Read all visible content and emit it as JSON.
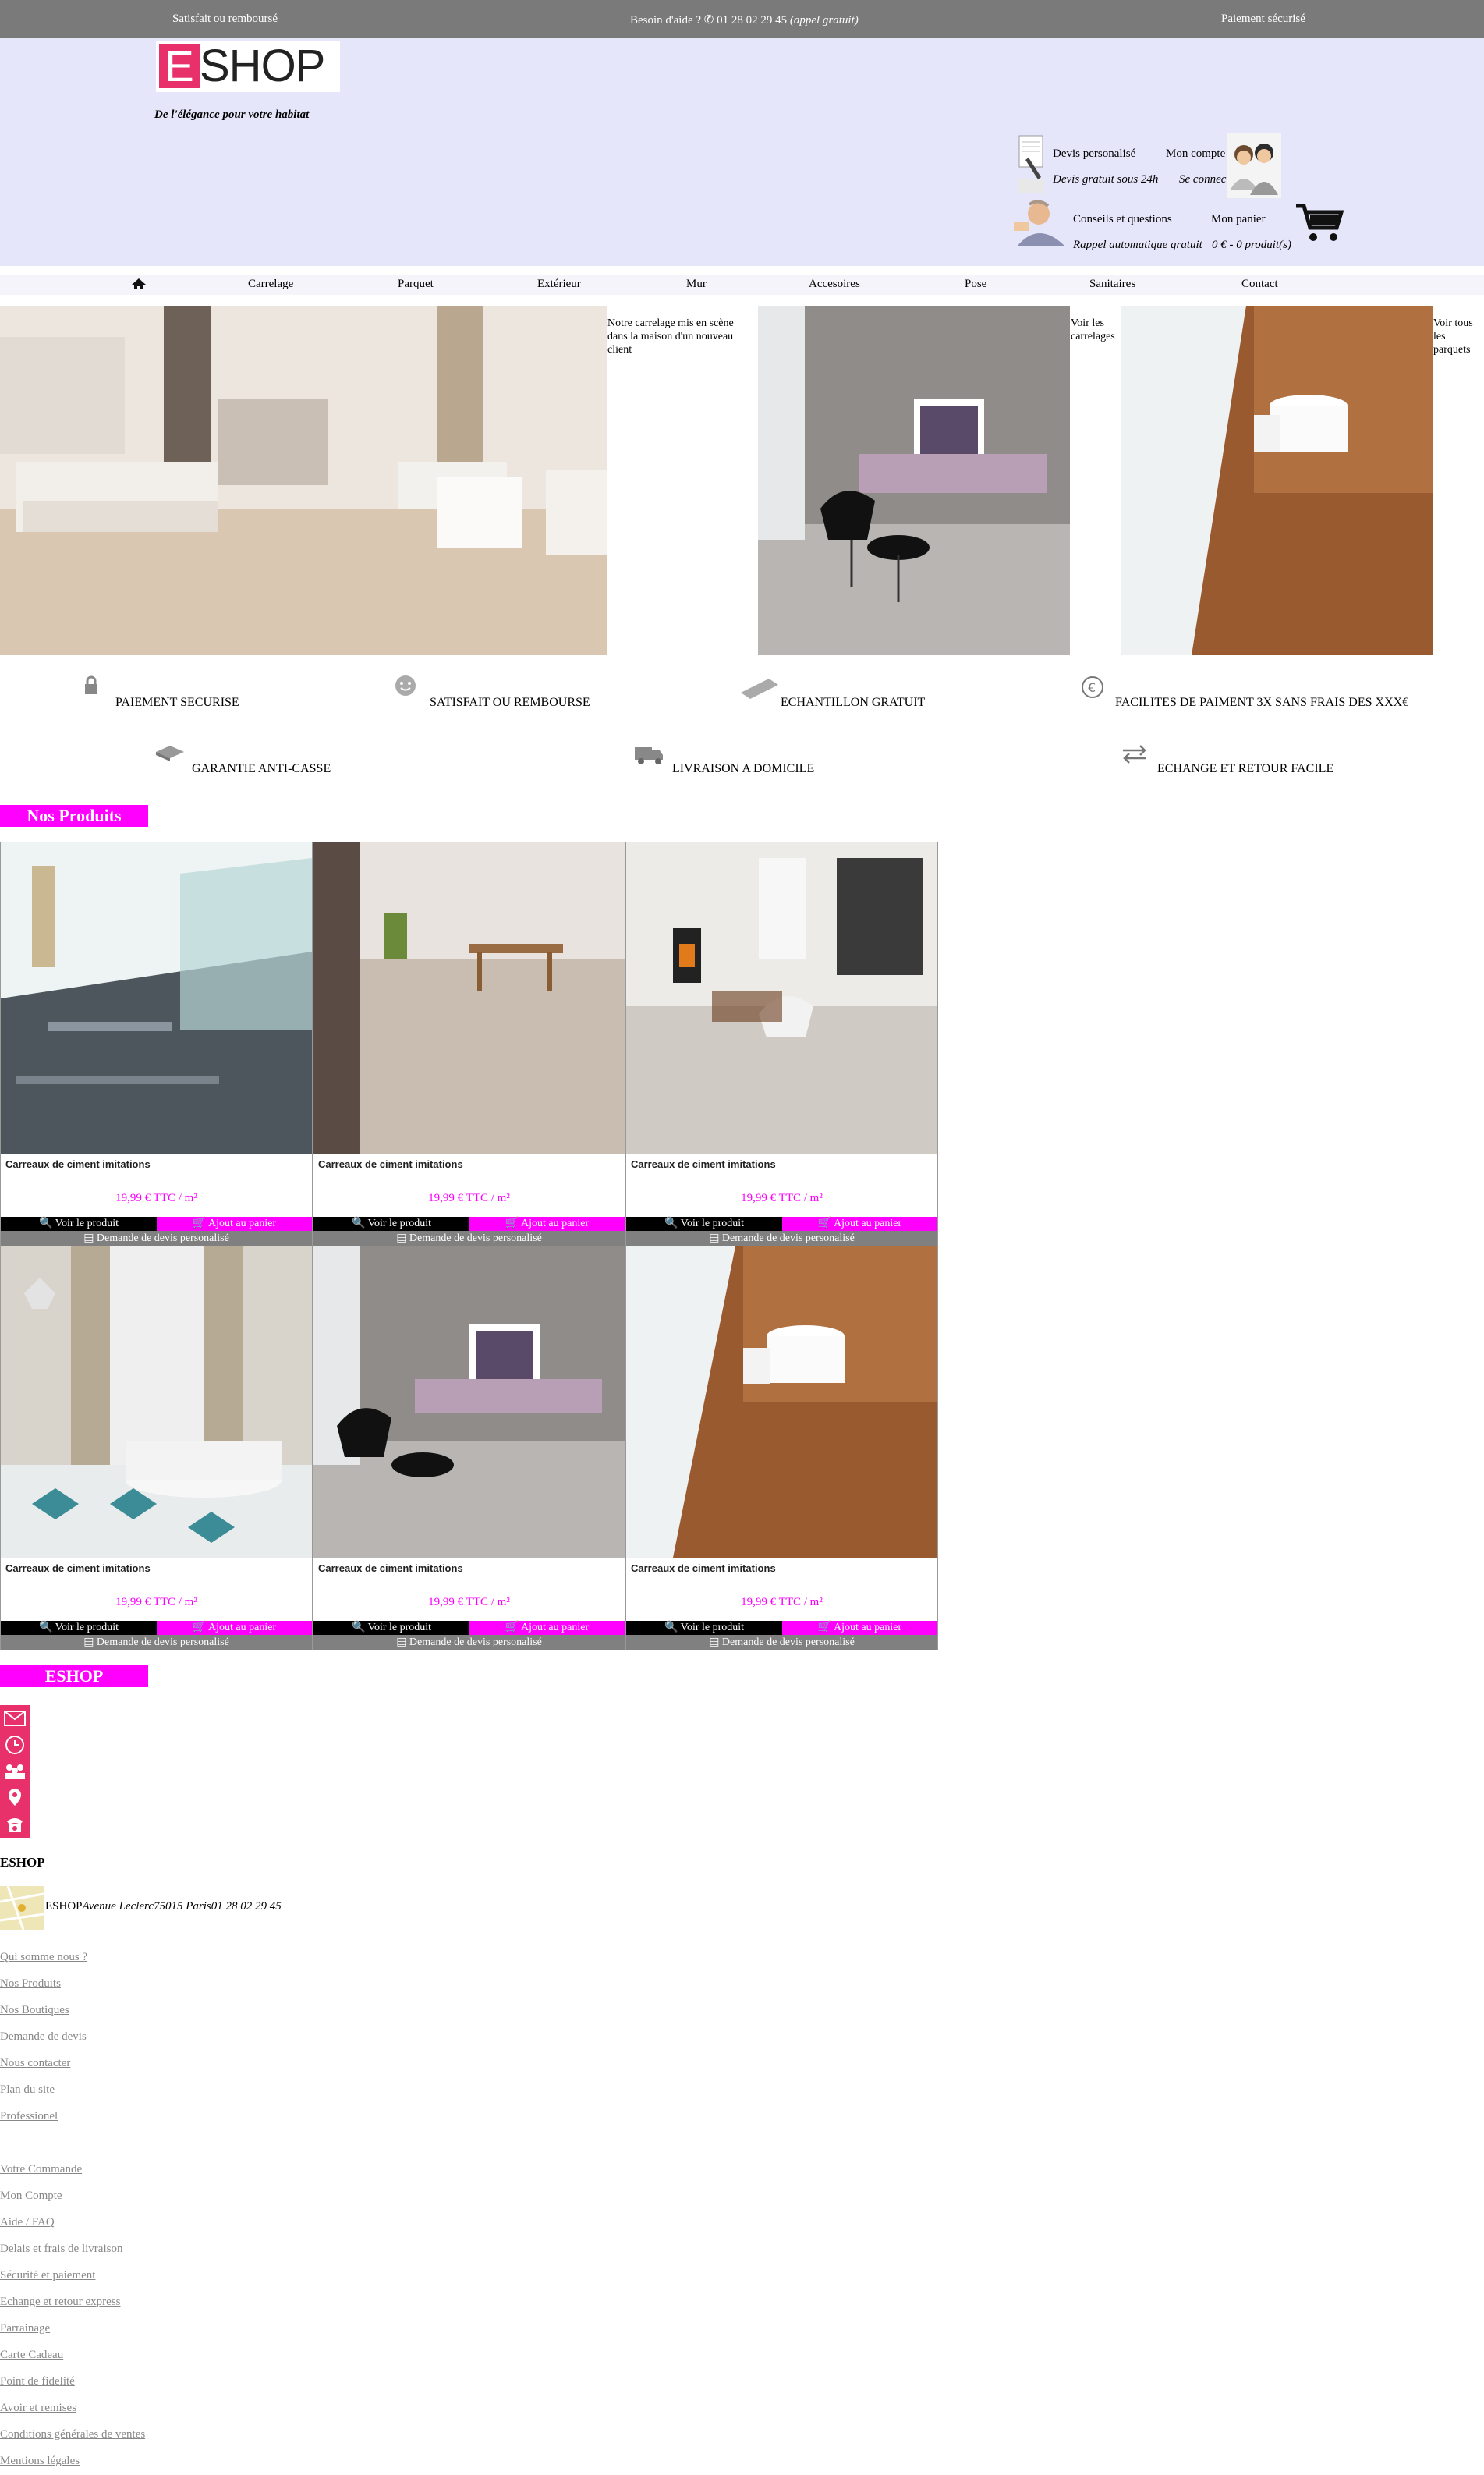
{
  "topbar": {
    "left": "Satisfait ou remboursé",
    "center_prefix": "Besoin d'aide ?",
    "phone": "01 28 02 29 45",
    "phone_note": "(appel gratuit)",
    "right": "Paiement sécurisé"
  },
  "header": {
    "logo_letter": "E",
    "logo_rest": "SHOP",
    "tagline": "De l'élégance pour votre habitat",
    "quote_label": "Devis personalisé",
    "quote_sub": "Devis gratuit sous 24h",
    "account_label": "Mon compte",
    "account_sub": "Se connecter",
    "advice_label": "Conseils et questions",
    "advice_sub": "Rappel automatique gratuit",
    "cart_label": "Mon panier",
    "cart_sub": "0 € - 0 produit(s)"
  },
  "nav": {
    "items": [
      "Carrelage",
      "Parquet",
      "Extérieur",
      "Mur",
      "Accesoires",
      "Pose",
      "Sanitaires",
      "Contact"
    ]
  },
  "hero": {
    "caption1": "Notre carrelage mis en scène dans la maison d'un nouveau client",
    "caption2": "Voir les carrelages",
    "caption3": "Voir tous les parquets"
  },
  "features": {
    "row1": [
      "PAIEMENT SECURISE",
      "SATISFAIT OU REMBOURSE",
      "ECHANTILLON GRATUIT",
      "FACILITES DE PAIMENT 3X SANS FRAIS DES XXX€"
    ],
    "row2": [
      "GARANTIE ANTI-CASSE",
      "LIVRAISON A DOMICILE",
      "ECHANGE ET RETOUR FACILE"
    ]
  },
  "products": {
    "section_title": "Nos Produits",
    "items": [
      {
        "name": "Carreaux de ciment imitations",
        "price": "19,99 € TTC / m²"
      },
      {
        "name": "Carreaux de ciment imitations",
        "price": "19,99 € TTC / m²"
      },
      {
        "name": "Carreaux de ciment imitations",
        "price": "19,99 € TTC / m²"
      },
      {
        "name": "Carreaux de ciment imitations",
        "price": "19,99 € TTC / m²"
      },
      {
        "name": "Carreaux de ciment imitations",
        "price": "19,99 € TTC / m²"
      },
      {
        "name": "Carreaux de ciment imitations",
        "price": "19,99 € TTC / m²"
      }
    ],
    "view_label": "Voir le produit",
    "cart_label": "Ajout au panier",
    "quote_label": "Demande de devis personalisé"
  },
  "eshop_section": {
    "title": "ESHOP",
    "icons": [
      "mail-icon",
      "clock-icon",
      "group-icon",
      "location-icon",
      "phone-icon"
    ]
  },
  "footer": {
    "title": "ESHOP",
    "address_name": "ESHOP",
    "address": "Avenue Leclerc75015 Paris01 28 02 29 45",
    "links1": [
      "Qui somme nous ?",
      "Nos Produits",
      "Nos Boutiques",
      "Demande de devis",
      "Nous contacter",
      "Plan du site",
      "Professionel"
    ],
    "links2": [
      "Votre Commande",
      "Mon Compte",
      "Aide / FAQ",
      "Delais et frais de livraison",
      "Sécurité et paiement",
      "Echange et retour express",
      "Parrainage",
      "Carte Cadeau",
      "Point de fidelité",
      "Avoir et remises",
      "Conditions générales de ventes",
      "Mentions légales"
    ]
  },
  "colors": {
    "accent": "#ff00ff",
    "brand": "#e8316b",
    "topbar": "#7a7a7a",
    "header_bg": "#e6e6fa"
  }
}
